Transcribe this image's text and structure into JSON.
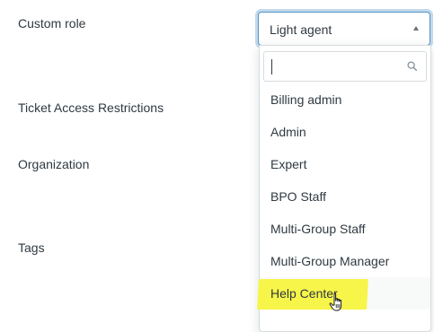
{
  "labels": {
    "custom_role": "Custom role",
    "ticket_access": "Ticket Access Restrictions",
    "organization": "Organization",
    "tags": "Tags"
  },
  "custom_role_select": {
    "selected": "Light agent",
    "search_value": "",
    "options": [
      "Billing admin",
      "Admin",
      "Expert",
      "BPO Staff",
      "Multi-Group Staff",
      "Multi-Group Manager",
      "Help Center"
    ],
    "hovered_option": "Help Center"
  },
  "colors": {
    "focus_border": "#5293c7",
    "highlight": "#f7f54a",
    "text": "#2f3941"
  },
  "icons": {
    "caret": "caret-up-icon",
    "search": "search-icon",
    "cursor": "hand-pointer-cursor"
  }
}
